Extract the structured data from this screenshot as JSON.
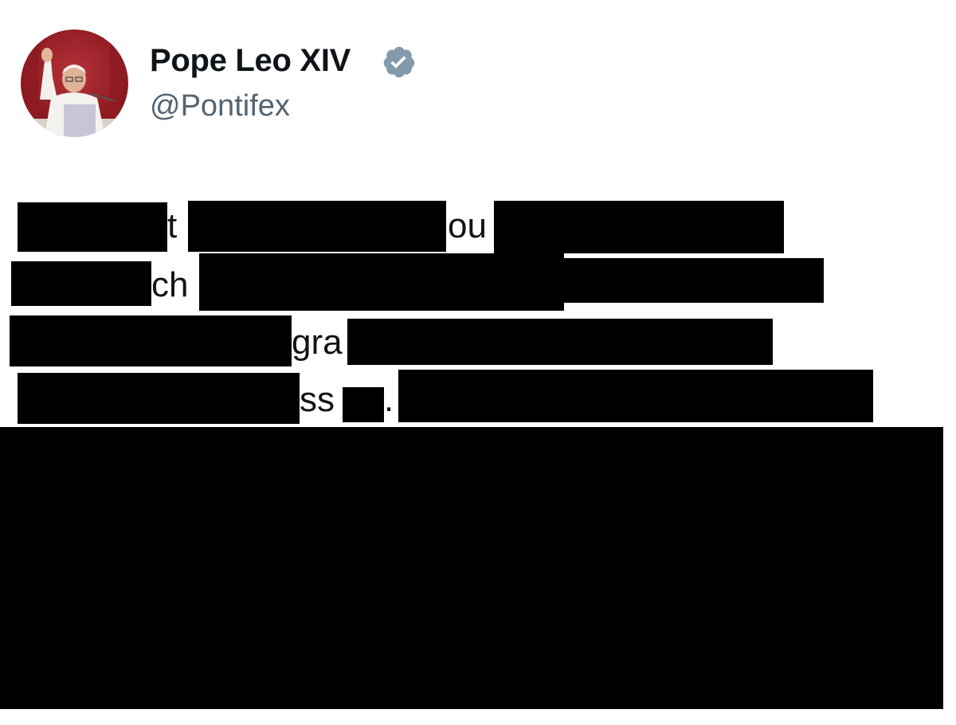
{
  "author": {
    "display_name": "Pope Leo XIV",
    "handle": "@Pontifex",
    "verified": true,
    "verified_badge_color": "#829aab",
    "avatar_icon": "pope-waving-photo"
  },
  "tweet": {
    "visible_fragments": [
      "t",
      "ou",
      "ch",
      "gra",
      "ss",
      "."
    ],
    "redaction_color": "#000000"
  }
}
